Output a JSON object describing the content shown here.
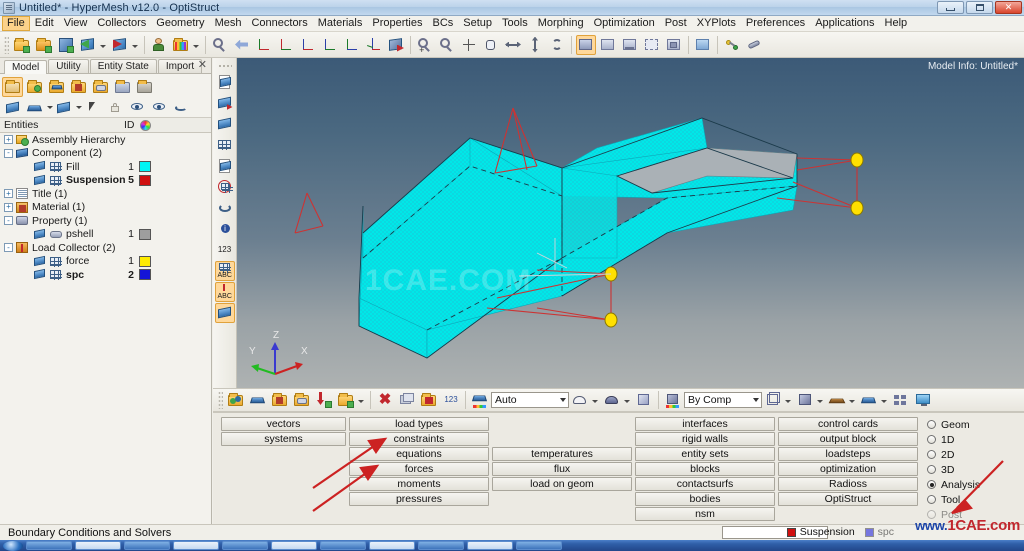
{
  "window": {
    "title": "Untitled* - HyperMesh v12.0 - OptiStruct",
    "app_icon": "hypermesh-icon",
    "buttons": {
      "minimize": "minimize-button",
      "restore": "restore-button",
      "close": "close-button"
    }
  },
  "menu": [
    {
      "label": "File",
      "active": true
    },
    {
      "label": "Edit",
      "active": false
    },
    {
      "label": "View",
      "active": false
    },
    {
      "label": "Collectors",
      "active": false
    },
    {
      "label": "Geometry",
      "active": false
    },
    {
      "label": "Mesh",
      "active": false
    },
    {
      "label": "Connectors",
      "active": false
    },
    {
      "label": "Materials",
      "active": false
    },
    {
      "label": "Properties",
      "active": false
    },
    {
      "label": "BCs",
      "active": false
    },
    {
      "label": "Setup",
      "active": false
    },
    {
      "label": "Tools",
      "active": false
    },
    {
      "label": "Morphing",
      "active": false
    },
    {
      "label": "Optimization",
      "active": false
    },
    {
      "label": "Post",
      "active": false
    },
    {
      "label": "XYPlots",
      "active": false
    },
    {
      "label": "Preferences",
      "active": false
    },
    {
      "label": "Applications",
      "active": false
    },
    {
      "label": "Help",
      "active": false
    }
  ],
  "toolbar": {
    "groups": [
      {
        "icons": [
          "open-model-icon",
          "import-icon",
          "save-icon",
          "export-icon",
          "export-dropdown",
          "load-icon",
          "load-dropdown"
        ]
      },
      {
        "icons": [
          "user-profile-icon",
          "color-palette-icon",
          "palette-dropdown"
        ]
      },
      {
        "icons": [
          "fit-view-icon",
          "back-view-icon",
          "xy-axis-icon",
          "yx-axis-icon",
          "zx-axis-icon",
          "zy-axis-icon",
          "yz-axis-icon",
          "zyx-axis-icon",
          "rotate-icon"
        ]
      },
      {
        "icons": [
          "zoom-in-icon",
          "zoom-out-icon",
          "pan-center-icon",
          "hand-pan-icon",
          "arrow-left-right-icon",
          "arrow-up-down-icon",
          "circle-rotate-icon"
        ]
      },
      {
        "icons": [
          "window-save-icon",
          "window-new-icon",
          "window-tile-icon",
          "window-dashed-icon",
          "window-sub-icon",
          "window-image-icon"
        ]
      },
      {
        "icons": [
          "connector-icon",
          "weld-icon"
        ]
      }
    ]
  },
  "left_panel": {
    "tabs": [
      {
        "label": "Model",
        "selected": true
      },
      {
        "label": "Utility",
        "selected": false
      },
      {
        "label": "Entity State",
        "selected": false
      },
      {
        "label": "Import",
        "selected": false
      }
    ],
    "close_icon": "close-icon",
    "icon_row_1": [
      "folder-icon",
      "assembly-icon",
      "component-icon",
      "material-icon",
      "property-icon",
      "loadcollector-icon",
      "systemcollector-icon"
    ],
    "icon_row_2": [
      "plate-icon",
      "diamond-icon",
      "diamond-dropdown",
      "plate2-icon",
      "plate2-dropdown",
      "cursor-icon",
      "lock-icon",
      "eye-plusminus-icon",
      "eye-1-icon",
      "swoosh-icon"
    ],
    "columns": {
      "entities": "Entities",
      "id": "ID",
      "color": "color-wheel-icon"
    },
    "tree": [
      {
        "label": "Assembly Hierarchy",
        "indent": 0,
        "toggle": "+",
        "icon": "assembly-icon",
        "id": "",
        "color": "",
        "bold": false
      },
      {
        "label": "Component (2)",
        "indent": 0,
        "toggle": "-",
        "icon": "component-icon",
        "id": "",
        "color": "",
        "bold": false
      },
      {
        "label": "Fill",
        "indent": 1,
        "toggle": "",
        "icon": "mesh-icon",
        "id": "1",
        "color": "#00f5f5",
        "bold": false
      },
      {
        "label": "Suspension",
        "indent": 1,
        "toggle": "",
        "icon": "mesh-icon",
        "id": "5",
        "color": "#d01010",
        "bold": true
      },
      {
        "label": "Title (1)",
        "indent": 0,
        "toggle": "+",
        "icon": "card-icon",
        "id": "",
        "color": "",
        "bold": false
      },
      {
        "label": "Material (1)",
        "indent": 0,
        "toggle": "+",
        "icon": "material-icon",
        "id": "",
        "color": "",
        "bold": false
      },
      {
        "label": "Property (1)",
        "indent": 0,
        "toggle": "-",
        "icon": "property-icon",
        "id": "",
        "color": "",
        "bold": false
      },
      {
        "label": "pshell",
        "indent": 1,
        "toggle": "",
        "icon": "pshell-icon",
        "id": "1",
        "color": "#9e9e9e",
        "bold": false
      },
      {
        "label": "Load Collector (2)",
        "indent": 0,
        "toggle": "-",
        "icon": "loadcollector-icon",
        "id": "",
        "color": "",
        "bold": false
      },
      {
        "label": "force",
        "indent": 1,
        "toggle": "",
        "icon": "mesh-icon",
        "id": "1",
        "color": "#ffec00",
        "bold": false
      },
      {
        "label": "spc",
        "indent": 1,
        "toggle": "",
        "icon": "mesh-icon",
        "id": "2",
        "color": "#1414d8",
        "bold": true
      }
    ]
  },
  "vertical_toolbar": {
    "icons": [
      "page-plate-icon",
      "plate-red-icon",
      "plate-blue-icon",
      "mesh-plate-icon",
      "plate-frame-icon",
      "circle-plate-icon",
      "swoosh-icon",
      "info-icon",
      "number-123-icon",
      "abc-mesh-icon",
      "abc-load-icon",
      "highlight-icon"
    ]
  },
  "graphics": {
    "model_info": "Model Info: Untitled*",
    "watermark": "1CAE.COM",
    "triad": {
      "x": "X",
      "y": "Y",
      "z": "Z"
    },
    "colors": {
      "mesh": "#00f0f0",
      "rigid": "#c83232",
      "node": "#ffe000",
      "bg_top": "#3c5a77",
      "bg_bottom": "#aeb2b2"
    }
  },
  "graphics_toolbar": {
    "icons_left": [
      "component-table-icon",
      "diamond-icon",
      "material-icon",
      "property-icon",
      "import-down-icon",
      "export-up-icon",
      "export-dropdown"
    ],
    "icons_mid": [
      "delete-icon",
      "mask-icon",
      "unmask-icon",
      "renumber-icon"
    ],
    "mode_combo": {
      "value": "Auto",
      "icon": "element-color-icon"
    },
    "icons_shade": [
      "shade-wire-icon",
      "shade-wire-dropdown",
      "shade-solid-icon",
      "shade-solid-dropdown",
      "cube-icon"
    ],
    "color_combo": {
      "value": "By Comp",
      "icon": "bycomp-icon"
    },
    "icons_right": [
      "wireframe-cube-icon",
      "wireframe-dropdown",
      "shaded-cube-icon",
      "shaded-dropdown",
      "element-face-icon",
      "element-face-dropdown",
      "shaded-plate-icon",
      "shaded-plate-dropdown",
      "mesh-lines-icon",
      "monitor-icon"
    ]
  },
  "panel": {
    "col1": [
      "vectors",
      "systems"
    ],
    "col2": [
      "load types",
      "constraints",
      "equations",
      "forces",
      "moments",
      "pressures"
    ],
    "col3": [
      "temperatures",
      "flux",
      "load on geom"
    ],
    "col4": [
      "interfaces",
      "rigid walls",
      "entity sets",
      "blocks",
      "contactsurfs",
      "bodies",
      "nsm"
    ],
    "col5": [
      "control cards",
      "output block",
      "loadsteps",
      "optimization",
      "Radioss",
      "OptiStruct"
    ],
    "radio_group": [
      {
        "label": "Geom",
        "selected": false
      },
      {
        "label": "1D",
        "selected": false
      },
      {
        "label": "2D",
        "selected": false
      },
      {
        "label": "3D",
        "selected": false
      },
      {
        "label": "Analysis",
        "selected": true
      },
      {
        "label": "Tool",
        "selected": false
      },
      {
        "label": "Post",
        "selected": false
      }
    ],
    "annotation_arrows": [
      "arrow-to-constraints",
      "arrow-to-forces",
      "arrow-to-analysis"
    ]
  },
  "status": {
    "message": "Boundary Conditions and Solvers",
    "current_component": {
      "label": "Suspension",
      "color": "#d01010"
    },
    "current_loadcollector": {
      "label": "spc",
      "color": "#1414d8"
    },
    "watermark": "www.1CAE.com"
  }
}
